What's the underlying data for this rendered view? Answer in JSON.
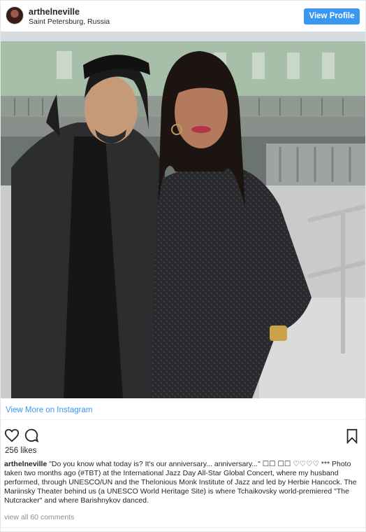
{
  "post": {
    "username": "arthelneville",
    "location": "Saint Petersburg, Russia",
    "view_profile_label": "View Profile",
    "photo_icon": "photo",
    "view_more_label": "View More on Instagram",
    "likes": "256 likes",
    "caption_user": "arthelneville",
    "caption_text": "\"Do you know what today is? It's our anniversary... anniversary...\" ☐☐ ☐☐ ♡♡♡♡ *** Photo taken two months ago (#TBT) at the International Jazz Day All-Star Global Concert, where my husband performed, through UNESCO/UN and the Thelonious Monk Institute of Jazz and led by Herbie Hancock. The Mariinsky Theater behind us (a UNESCO World Heritage Site) is where Tchaikovsky world-premiered \"The Nutcracker\" and where Barishnykov danced.",
    "view_all_comments": "view all 60 comments"
  },
  "icons": {
    "like": "heart-icon",
    "comment": "comment-icon",
    "save": "bookmark-icon"
  },
  "colors": {
    "accent": "#3897f0",
    "text": "#262626",
    "muted": "#8e8e8e"
  }
}
